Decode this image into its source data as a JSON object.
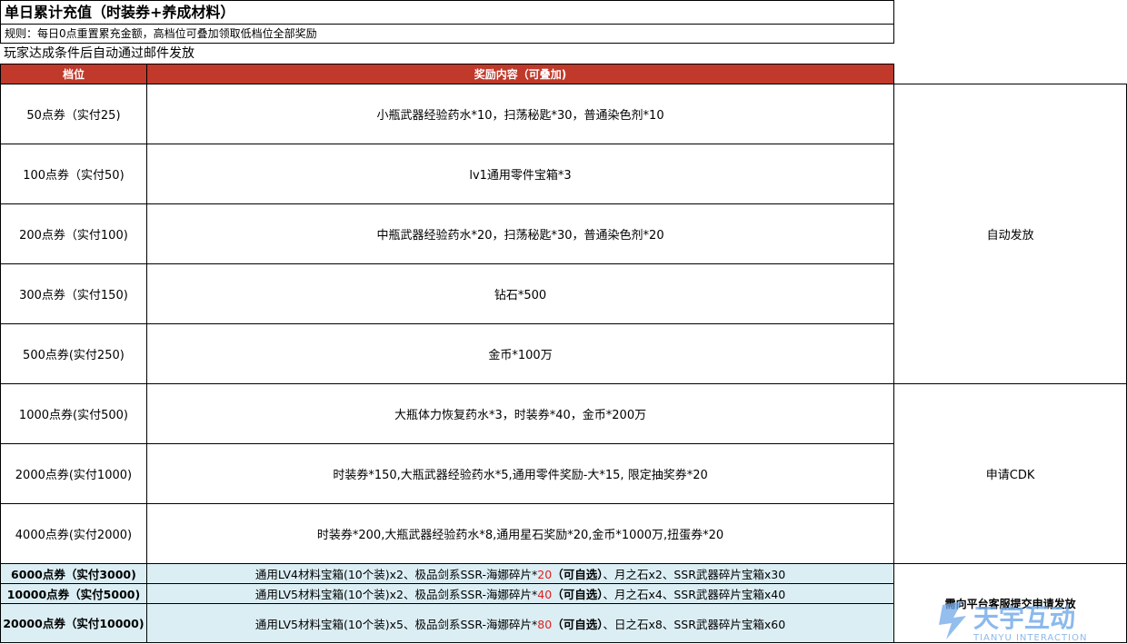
{
  "header": {
    "title": "单日累计充值（时装券+养成材料）",
    "rules": "规则：每日0点重置累充金额，高档位可叠加领取低档位全部奖励",
    "note": "玩家达成条件后自动通过邮件发放"
  },
  "table": {
    "col_tier": "档位",
    "col_reward": "奖励内容（可叠加)",
    "rows": [
      {
        "tier": "50点券（实付25)",
        "reward": "小瓶武器经验药水*10，扫荡秘匙*30，普通染色剂*10"
      },
      {
        "tier": "100点券（实付50)",
        "reward": "lv1通用零件宝箱*3"
      },
      {
        "tier": "200点券（实付100)",
        "reward": "中瓶武器经验药水*20，扫荡秘匙*30，普通染色剂*20"
      },
      {
        "tier": "300点券（实付150)",
        "reward": "钻石*500"
      },
      {
        "tier": "500点券(实付250)",
        "reward": "金币*100万"
      },
      {
        "tier": "1000点券(实付500)",
        "reward": "大瓶体力恢复药水*3，时装券*40，金币*200万"
      },
      {
        "tier": "2000点券(实付1000)",
        "reward": "时装券*150,大瓶武器经验药水*5,通用零件奖励-大*15, 限定抽奖券*20"
      },
      {
        "tier": "4000点券(实付2000)",
        "reward": "时装券*200,大瓶武器经验药水*8,通用星石奖励*20,金币*1000万,扭蛋券*20"
      }
    ],
    "high_rows": [
      {
        "tier": "6000点券（实付3000)",
        "pre": "通用LV4材料宝箱(10个装)x2、极品剑系SSR-海娜碎片*",
        "num": "20",
        "choice": "（可自选）",
        "post": "、月之石x2、SSR武器碎片宝箱x30"
      },
      {
        "tier": "10000点券（实付5000)",
        "pre": "通用LV5材料宝箱(10个装)x2、极品剑系SSR-海娜碎片*",
        "num": "40",
        "choice": "（可自选）",
        "post": "、月之石x4、SSR武器碎片宝箱x40"
      },
      {
        "tier": "20000点券（实付10000)",
        "pre": "通用LV5材料宝箱(10个装)x5、极品剑系SSR-海娜碎片*",
        "num": "80",
        "choice": "（可自选）",
        "post": "、日之石x8、SSR武器碎片宝箱x60"
      }
    ],
    "method_auto": "自动发放",
    "method_cdk": "申请CDK",
    "method_service": "需向平台客服提交申请发放"
  },
  "watermark": {
    "brand": "天宇互动",
    "sub": "TIANYU INTERACTION"
  }
}
